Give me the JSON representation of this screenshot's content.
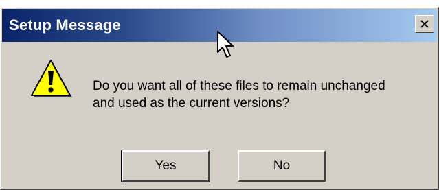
{
  "window": {
    "title": "Setup Message",
    "close_icon": "close-icon",
    "colors": {
      "title_gradient_start": "#0a246a",
      "title_gradient_end": "#a6caf0",
      "face": "#d4d0c8"
    }
  },
  "message": {
    "icon": "warning-icon",
    "lines": [
      "Do you want all of these files to remain unchanged",
      "and used as the current versions?"
    ]
  },
  "buttons": {
    "yes_label": "Yes",
    "no_label": "No"
  },
  "cursor": {
    "icon": "mouse-pointer-icon"
  }
}
